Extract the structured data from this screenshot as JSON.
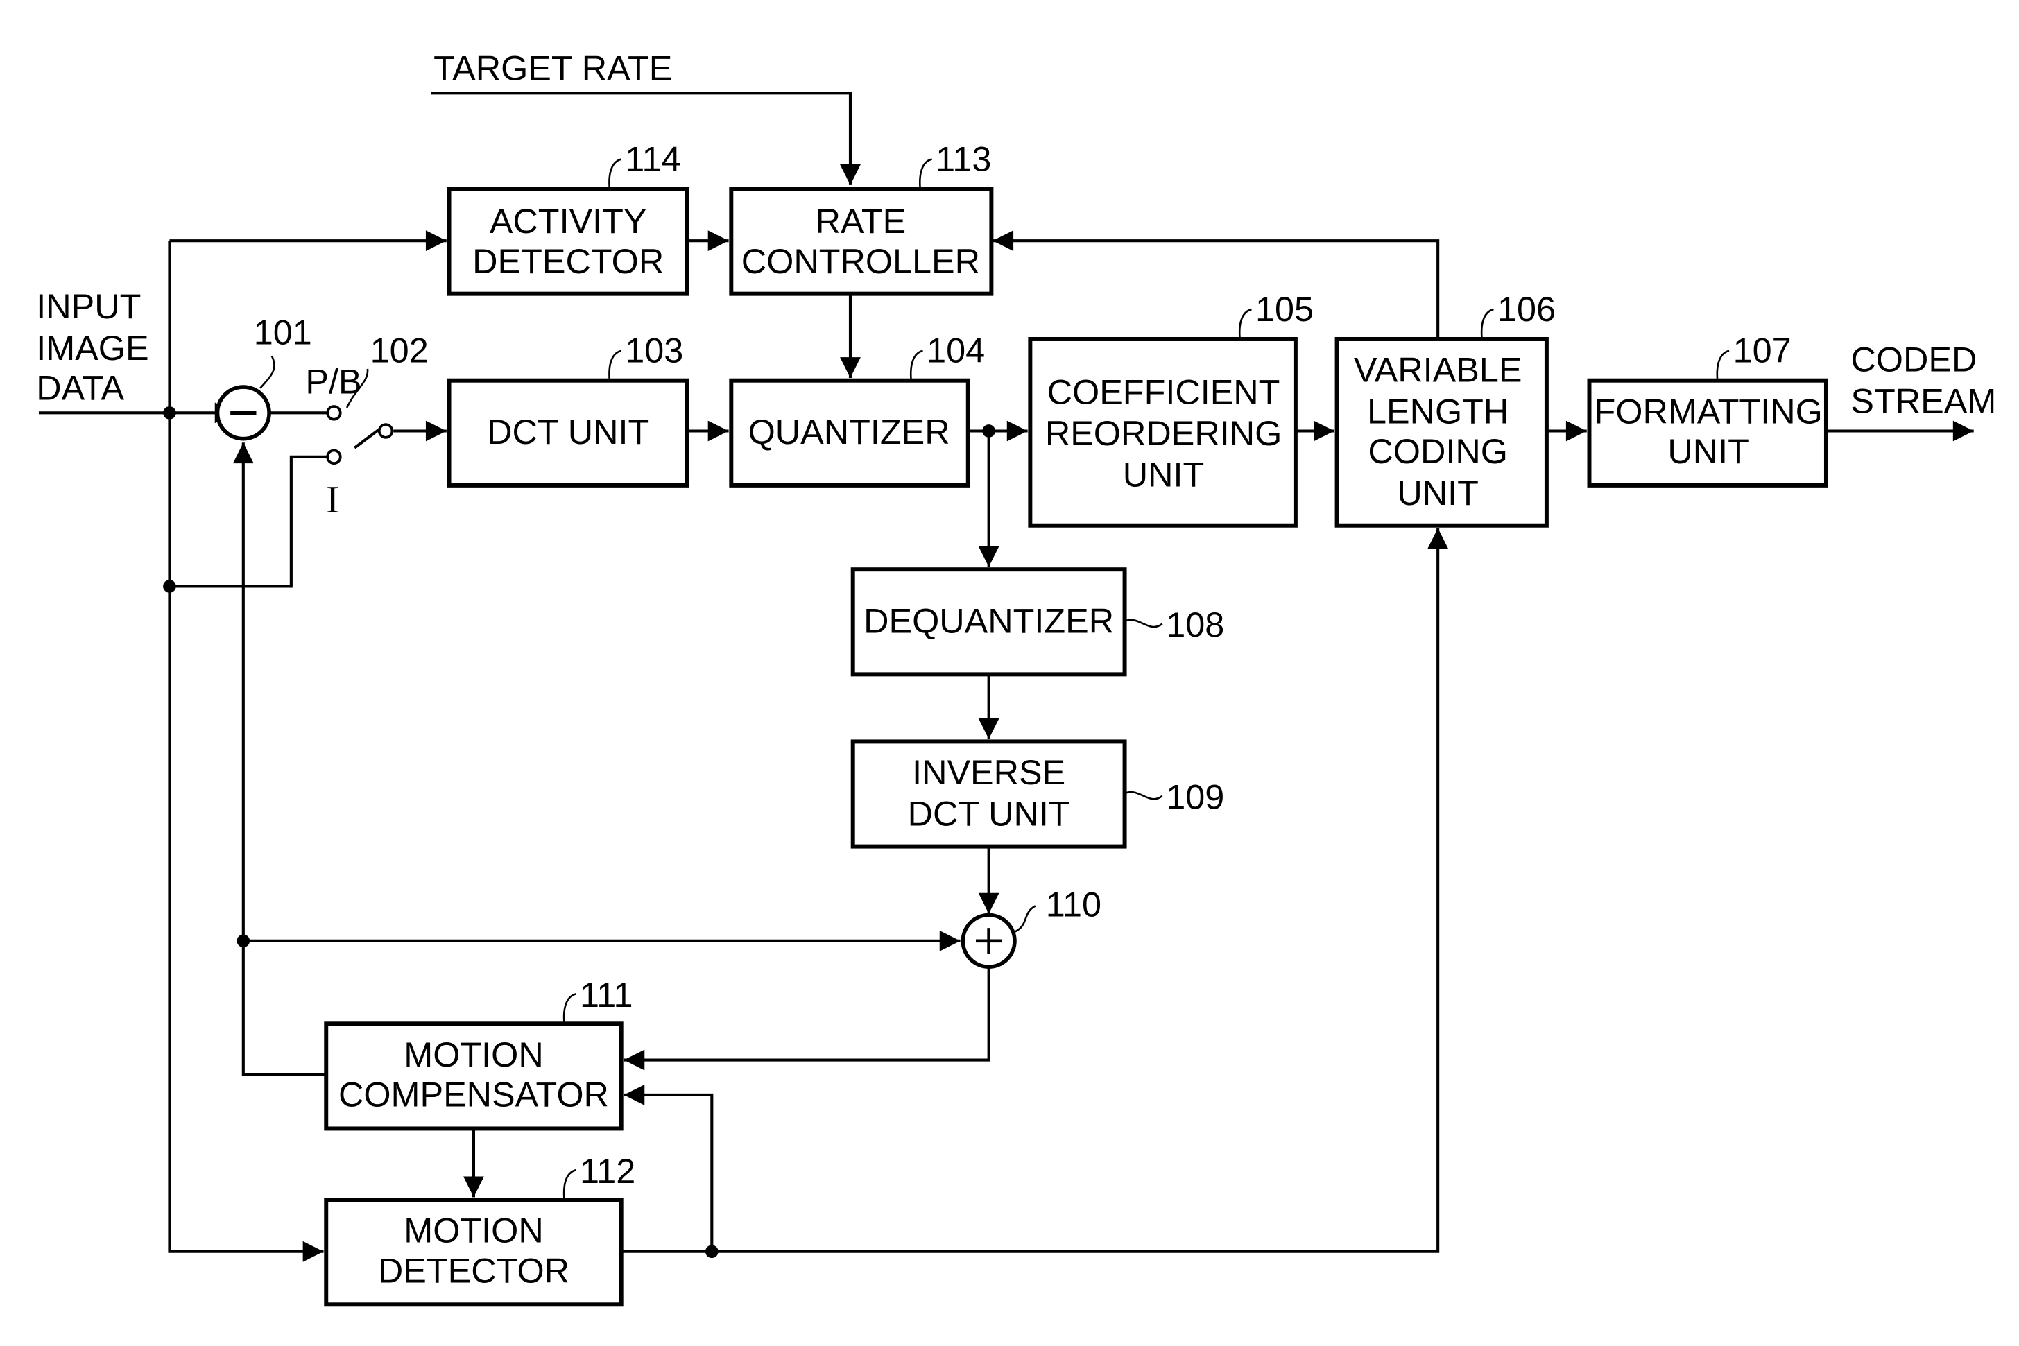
{
  "diagram": {
    "inputs": {
      "target_rate": "TARGET RATE",
      "input_image_data": [
        "INPUT",
        "IMAGE",
        "DATA"
      ]
    },
    "outputs": {
      "coded_stream": [
        "CODED",
        "STREAM"
      ]
    },
    "blocks": {
      "activity_detector": {
        "ref": "114",
        "lines": [
          "ACTIVITY",
          "DETECTOR"
        ]
      },
      "rate_controller": {
        "ref": "113",
        "lines": [
          "RATE",
          "CONTROLLER"
        ]
      },
      "dct_unit": {
        "ref": "103",
        "lines": [
          "DCT UNIT"
        ]
      },
      "quantizer": {
        "ref": "104",
        "lines": [
          "QUANTIZER"
        ]
      },
      "coefficient_reordering_unit": {
        "ref": "105",
        "lines": [
          "COEFFICIENT",
          "REORDERING",
          "UNIT"
        ]
      },
      "variable_length_coding_unit": {
        "ref": "106",
        "lines": [
          "VARIABLE",
          "LENGTH",
          "CODING",
          "UNIT"
        ]
      },
      "formatting_unit": {
        "ref": "107",
        "lines": [
          "FORMATTING",
          "UNIT"
        ]
      },
      "dequantizer": {
        "ref": "108",
        "lines": [
          "DEQUANTIZER"
        ]
      },
      "inverse_dct_unit": {
        "ref": "109",
        "lines": [
          "INVERSE",
          "DCT UNIT"
        ]
      },
      "motion_compensator": {
        "ref": "111",
        "lines": [
          "MOTION",
          "COMPENSATOR"
        ]
      },
      "motion_detector": {
        "ref": "112",
        "lines": [
          "MOTION",
          "DETECTOR"
        ]
      }
    },
    "nodes": {
      "subtractor": {
        "ref": "101",
        "symbol": "minus"
      },
      "switch": {
        "ref": "102",
        "pb_label": "P/B",
        "i_label": "I"
      },
      "adder": {
        "ref": "110",
        "symbol": "plus"
      }
    }
  }
}
